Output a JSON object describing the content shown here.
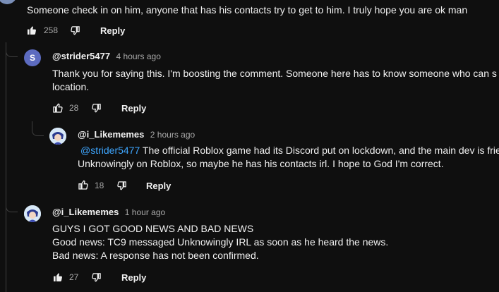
{
  "comments": [
    {
      "text": "Someone check in on him, anyone that has his contacts try to get to him. I truly hope you are ok man",
      "likes": "258",
      "reply_label": "Reply"
    },
    {
      "avatar_letter": "S",
      "avatar_color": "#5c6bc0",
      "handle": "@strider5477",
      "time": "4 hours ago",
      "text_line1": "Thank you for saying this.  I'm boosting the comment.  Someone here has to know someone who can s",
      "text_line2": "location.",
      "likes": "28",
      "reply_label": "Reply"
    },
    {
      "handle": "@i_Likememes",
      "time": "2 hours ago",
      "mention": "@strider5477",
      "text_line1": " The official Roblox game had its Discord put on lockdown, and the main dev is frie",
      "text_line2": "Unknowingly on Roblox, so maybe he has his contacts irl. I hope to God I'm correct.",
      "likes": "18",
      "reply_label": "Reply"
    },
    {
      "handle": "@i_Likememes",
      "time": "1 hour ago",
      "text_line1": "GUYS I GOT GOOD NEWS AND BAD NEWS",
      "text_line2": "Good news: TC9 messaged Unknowingly IRL as soon as he heard the news.",
      "text_line3": "Bad news: A response has not been confirmed.",
      "likes": "27",
      "reply_label": "Reply"
    }
  ]
}
